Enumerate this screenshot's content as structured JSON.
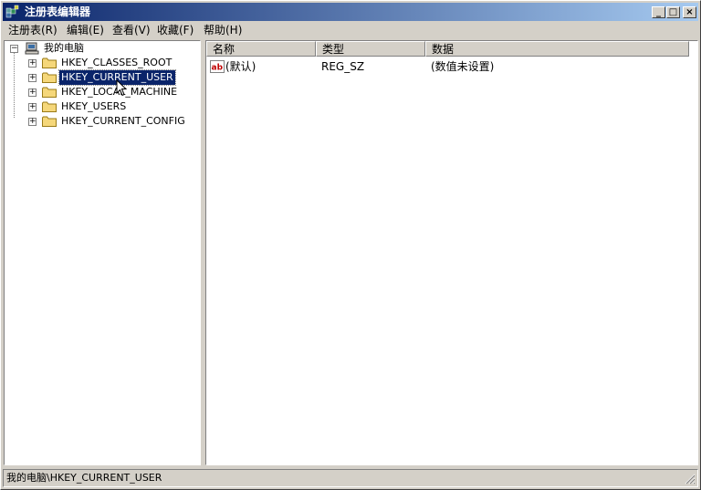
{
  "window": {
    "title": "注册表编辑器"
  },
  "menu": [
    {
      "label": "注册表(R)"
    },
    {
      "label": "编辑(E)"
    },
    {
      "label": "查看(V)"
    },
    {
      "label": "收藏(F)"
    },
    {
      "label": "帮助(H)"
    }
  ],
  "tree": {
    "root": "我的电脑",
    "items": [
      {
        "label": "HKEY_CLASSES_ROOT",
        "selected": false
      },
      {
        "label": "HKEY_CURRENT_USER",
        "selected": true
      },
      {
        "label": "HKEY_LOCAL_MACHINE",
        "selected": false
      },
      {
        "label": "HKEY_USERS",
        "selected": false
      },
      {
        "label": "HKEY_CURRENT_CONFIG",
        "selected": false
      }
    ]
  },
  "list": {
    "columns": [
      "名称",
      "类型",
      "数据"
    ],
    "rows": [
      {
        "name": "(默认)",
        "type": "REG_SZ",
        "data": "(数值未设置)",
        "icon": "string-value-icon"
      }
    ]
  },
  "status": {
    "path": "我的电脑\\HKEY_CURRENT_USER"
  },
  "colors": {
    "title_start": "#0a246a",
    "title_end": "#a6caf0",
    "selection": "#0a246a",
    "face": "#d4d0c8"
  }
}
